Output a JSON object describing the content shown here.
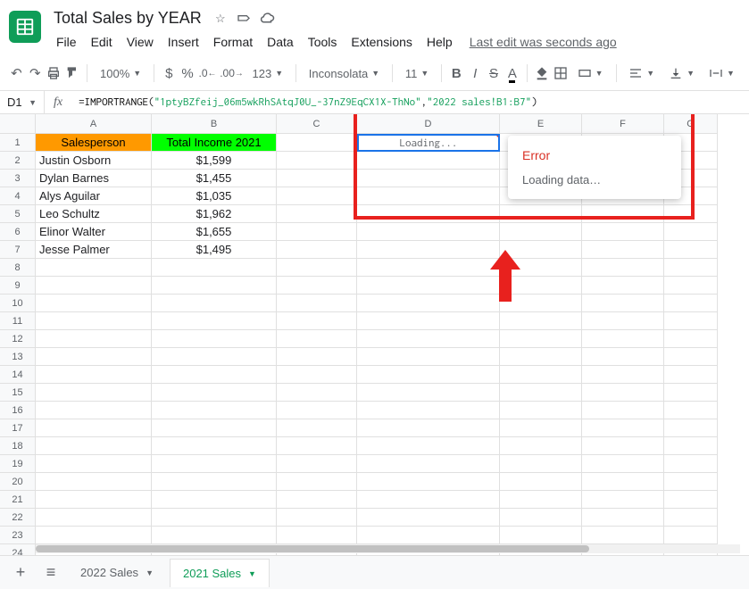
{
  "doc_title": "Total Sales by YEAR",
  "menu": [
    "File",
    "Edit",
    "View",
    "Insert",
    "Format",
    "Data",
    "Tools",
    "Extensions",
    "Help"
  ],
  "last_edit": "Last edit was seconds ago",
  "toolbar": {
    "zoom": "100%",
    "font": "Inconsolata",
    "size": "11",
    "format": "123"
  },
  "name_box": "D1",
  "formula": {
    "fn": "=IMPORTRANGE",
    "arg1": "\"1ptyBZfeij_06m5wkRhSAtqJ0U_-37nZ9EqCX1X-ThNo\"",
    "arg2": "\"2022 sales!B1:B7\""
  },
  "columns": [
    "A",
    "B",
    "C",
    "D",
    "E",
    "F",
    "G"
  ],
  "headers": {
    "a": "Salesperson",
    "b": "Total Income 2021"
  },
  "rows": [
    {
      "a": "Justin Osborn",
      "b": "$1,599"
    },
    {
      "a": "Dylan Barnes",
      "b": "$1,455"
    },
    {
      "a": "Alys Aguilar",
      "b": "$1,035"
    },
    {
      "a": "Leo Schultz",
      "b": "$1,962"
    },
    {
      "a": "Elinor Walter",
      "b": "$1,655"
    },
    {
      "a": "Jesse Palmer",
      "b": "$1,495"
    }
  ],
  "loading_text": "Loading...",
  "tooltip": {
    "title": "Error",
    "body": "Loading data…"
  },
  "sheets": {
    "left": "2022 Sales",
    "active": "2021 Sales"
  }
}
